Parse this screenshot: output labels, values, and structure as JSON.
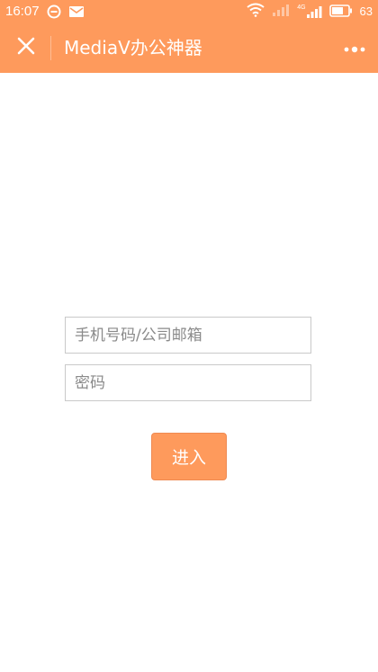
{
  "status_bar": {
    "time": "16:07",
    "battery_level": "63",
    "network_label": "4G",
    "icons": [
      "sync-icon",
      "mail-icon",
      "wifi-icon",
      "signal-icon",
      "signal-4g-icon",
      "battery-icon"
    ]
  },
  "header": {
    "title": "MediaV办公神器",
    "close_icon": "close-icon",
    "more_icon": "more-icon"
  },
  "form": {
    "account_placeholder": "手机号码/公司邮箱",
    "password_placeholder": "密码",
    "submit_label": "进入"
  },
  "colors": {
    "accent": "#fe9a5c",
    "field_border": "#c9c9c9",
    "placeholder": "#8a8a8a",
    "background": "#ffffff"
  }
}
